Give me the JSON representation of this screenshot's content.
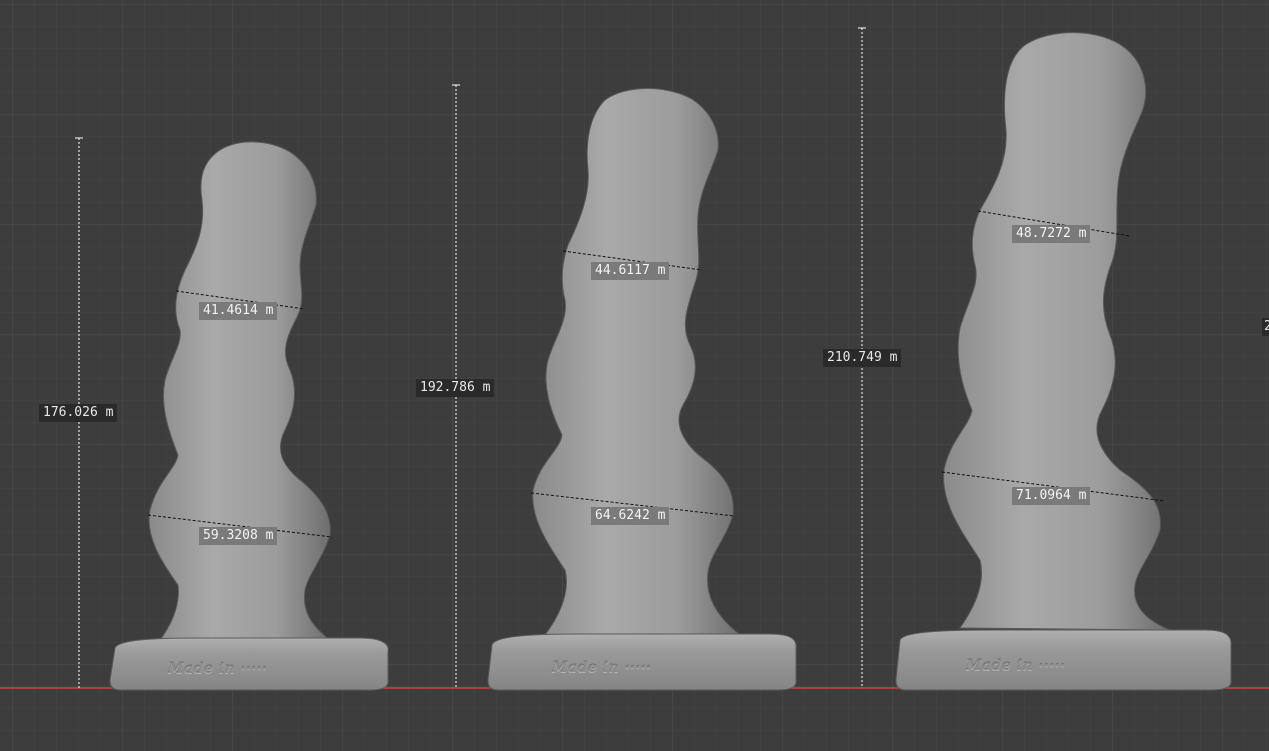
{
  "viewport": {
    "background_color": "#3d3d3d",
    "grid_minor_color": "#444444",
    "grid_major_color": "#4e4e4e",
    "x_axis_color": "#d04848",
    "mesh_color": "#9e9e9e"
  },
  "models": [
    {
      "height_label": "176.026 m",
      "upper_width_label": "41.4614 m",
      "lower_width_label": "59.3208 m",
      "base_text": "Made in ·····"
    },
    {
      "height_label": "192.786 m",
      "upper_width_label": "44.6117 m",
      "lower_width_label": "64.6242 m",
      "base_text": "Made in ·····"
    },
    {
      "height_label": "210.749 m",
      "upper_width_label": "48.7272 m",
      "lower_width_label": "71.0964 m",
      "base_text": "Made in ·····"
    }
  ],
  "offscreen_label_fragment": "2"
}
